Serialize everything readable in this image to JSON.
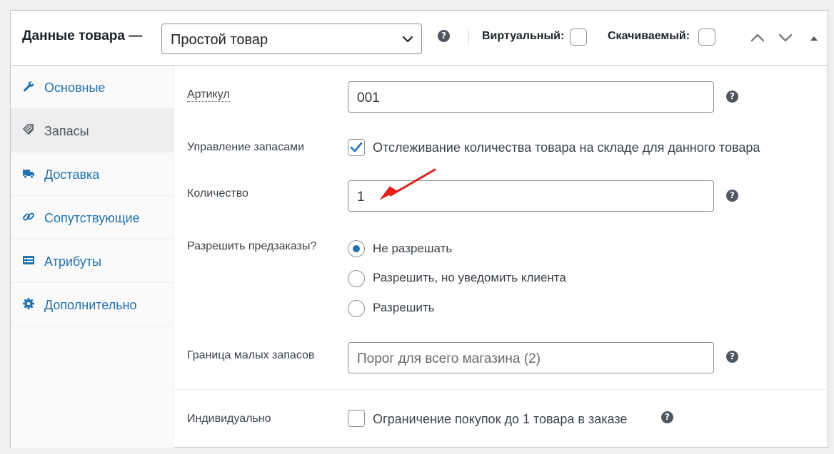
{
  "header": {
    "title": "Данные товара —",
    "product_type": {
      "value": "Простой товар",
      "options": [
        "Простой товар"
      ]
    },
    "help_icon": "?",
    "virtual_label": "Виртуальный:",
    "virtual_checked": false,
    "downloadable_label": "Скачиваемый:",
    "downloadable_checked": false
  },
  "sidebar": {
    "items": [
      {
        "label": "Основные",
        "icon": "wrench-icon",
        "active": false
      },
      {
        "label": "Запасы",
        "icon": "tag-icon",
        "active": true
      },
      {
        "label": "Доставка",
        "icon": "truck-icon",
        "active": false
      },
      {
        "label": "Сопутствующие",
        "icon": "link-icon",
        "active": false
      },
      {
        "label": "Атрибуты",
        "icon": "list-card-icon",
        "active": false
      },
      {
        "label": "Дополнительно",
        "icon": "gear-icon",
        "active": false
      }
    ]
  },
  "inventory": {
    "sku": {
      "label": "Артикул",
      "value": "001"
    },
    "manage_stock": {
      "label": "Управление запасами",
      "checkbox_label": "Отслеживание количества товара на складе для данного товара",
      "checked": true
    },
    "quantity": {
      "label": "Количество",
      "value": "1"
    },
    "backorders": {
      "label": "Разрешить предзаказы?",
      "options": [
        {
          "label": "Не разрешать",
          "selected": true
        },
        {
          "label": "Разрешить, но уведомить клиента",
          "selected": false
        },
        {
          "label": "Разрешить",
          "selected": false
        }
      ]
    },
    "low_stock": {
      "label": "Граница малых запасов",
      "placeholder": "Порог для всего магазина (2)"
    },
    "sold_individually": {
      "label": "Индивидуально",
      "checkbox_label": "Ограничение покупок до 1 товара в заказе",
      "checked": false
    }
  },
  "colors": {
    "accent": "#2271b1",
    "annotation_arrow": "#e0201a",
    "text": "#3c434a"
  }
}
